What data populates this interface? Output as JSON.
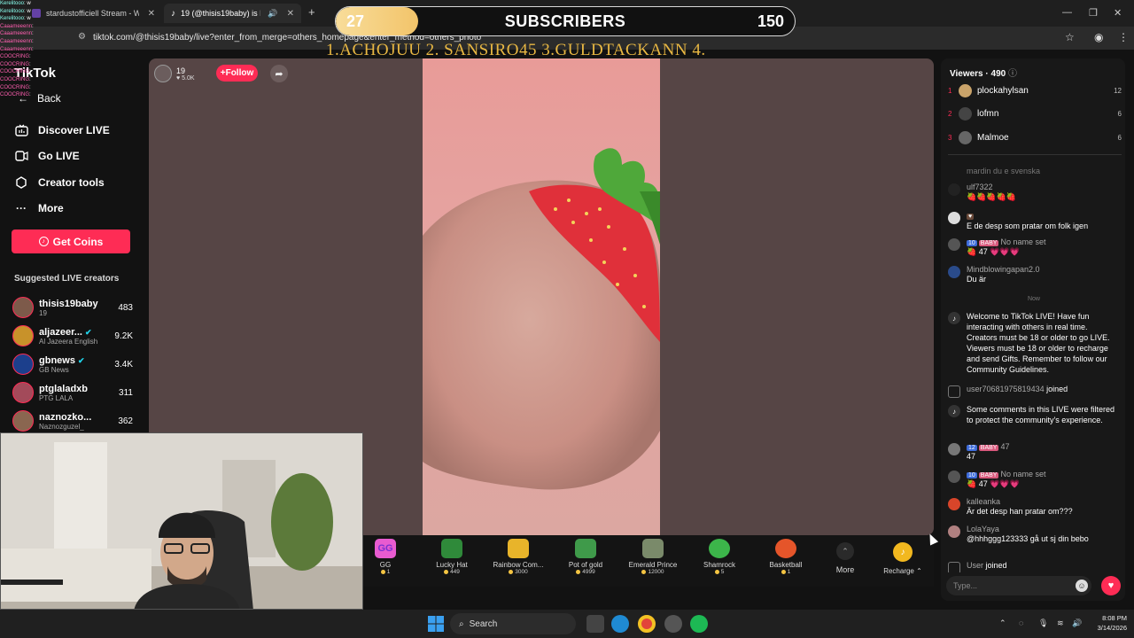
{
  "browser": {
    "tabs": [
      {
        "title": "stardustofficiell Stream - Watch",
        "active": false
      },
      {
        "title": "19 (@thisis19baby) is LIVE",
        "active": true
      }
    ],
    "url": "tiktok.com/@thisis19baby/live?enter_from_merge=others_homepage&enter_method=others_photo"
  },
  "overlay": {
    "subscribers_current": "27",
    "subscribers_label": "SUBSCRIBERS",
    "subscribers_goal": "150",
    "subscribers_progress": 0.18,
    "ranking": "1.ACHOJUU  2. SANSIRO45  3.GULDTACKANN  4."
  },
  "chat_overlay": [
    {
      "user": "Kerelitooo",
      "msg": ": w"
    },
    {
      "user": "Kerelitooo",
      "msg": ": w"
    },
    {
      "user": "Kerelitooo",
      "msg": ": w"
    },
    {
      "user": "Caaameeenn",
      "msg": ":"
    },
    {
      "user": "Caaameeenn",
      "msg": ":"
    },
    {
      "user": "Caaameeenn",
      "msg": ":"
    },
    {
      "user": "Caaameeenn",
      "msg": ":"
    },
    {
      "user": "COOCRING",
      "msg": ":"
    },
    {
      "user": "COOCRING",
      "msg": ":"
    },
    {
      "user": "COOCRING",
      "msg": ":"
    },
    {
      "user": "COOCRING",
      "msg": ":"
    },
    {
      "user": "COOCRING",
      "msg": ":"
    },
    {
      "user": "COOCRING",
      "msg": ":"
    }
  ],
  "sidebar": {
    "logo": "TikTok",
    "back": "Back",
    "nav": [
      {
        "label": "Discover LIVE",
        "icon": "discover-live-icon"
      },
      {
        "label": "Go LIVE",
        "icon": "go-live-icon"
      },
      {
        "label": "Creator tools",
        "icon": "creator-tools-icon"
      },
      {
        "label": "More",
        "icon": "more-icon"
      }
    ],
    "get_coins": "Get Coins",
    "suggested_title": "Suggested LIVE creators",
    "creators": [
      {
        "name": "thisis19baby",
        "sub": "19",
        "count": "483",
        "color": "#7d5a4a"
      },
      {
        "name": "aljazeer...",
        "sub": "Al Jazeera English",
        "count": "9.2K",
        "color": "#c8922a",
        "verified": true
      },
      {
        "name": "gbnews",
        "sub": "GB News",
        "count": "3.4K",
        "color": "#1c3f8c",
        "verified": true
      },
      {
        "name": "ptglaladxb",
        "sub": "PTG LALA",
        "count": "311",
        "color": "#a34a5a"
      },
      {
        "name": "naznozko...",
        "sub": "Naznozguzel_",
        "count": "362",
        "color": "#8a6650"
      }
    ]
  },
  "stream": {
    "host_name": "19",
    "host_likes": "5.0K",
    "follow": "+Follow"
  },
  "gifts": [
    {
      "name": "GG",
      "price": "1",
      "color": "#e85bd0"
    },
    {
      "name": "Lucky Hat",
      "price": "449",
      "color": "#2f8a3a"
    },
    {
      "name": "Rainbow Com...",
      "price": "3000",
      "color": "#e8b42a"
    },
    {
      "name": "Pot of gold",
      "price": "4999",
      "color": "#3f9a4a"
    },
    {
      "name": "Emerald Prince",
      "price": "12000",
      "color": "#7a8a6a"
    },
    {
      "name": "Shamrock",
      "price": "5",
      "color": "#3cb54a"
    },
    {
      "name": "Basketball",
      "price": "1",
      "color": "#e5552a"
    }
  ],
  "gift_more": "More",
  "recharge": "Recharge",
  "viewers": {
    "title": "Viewers · 490",
    "top": [
      {
        "rank": "1",
        "name": "plockahylsan",
        "score": "12",
        "color": "#c9a36a"
      },
      {
        "rank": "2",
        "name": "lofmn",
        "score": "6",
        "color": "#444"
      },
      {
        "rank": "3",
        "name": "Malmoe",
        "score": "6",
        "color": "#666"
      }
    ]
  },
  "chat": {
    "faded": "mardin du e svenska",
    "messages": [
      {
        "user": "ulf7322",
        "text": "🍓🍓🍓🍓🍓",
        "color": "#222"
      },
      {
        "user": "",
        "text": "E de desp som pratar om folk igen",
        "color": "#ddd"
      },
      {
        "user": "No name set",
        "badges": [
          "10",
          "BABY"
        ],
        "text": "🍓 47 💗💗💗",
        "color": "#555"
      },
      {
        "user": "Mindblowingapan2.0",
        "text": "Du är",
        "color": "#2a4b8a"
      }
    ],
    "now_label": "Now",
    "system1": "Welcome to TikTok LIVE! Have fun interacting with others in real time. Creators must be 18 or older to go LIVE. Viewers must be 18 or older to recharge and send Gifts. Remember to follow our Community Guidelines.",
    "joined1_user": "user70681975819434",
    "joined_label": "joined",
    "system2": "Some comments in this LIVE were filtered to protect the community's experience.",
    "messages2": [
      {
        "user": "47",
        "badges": [
          "12",
          "BABY"
        ],
        "text": "47",
        "color": "#777"
      },
      {
        "user": "No name set",
        "badges": [
          "10",
          "BABY"
        ],
        "text": "🍓 47 💗💗💗",
        "color": "#555"
      },
      {
        "user": "kalleanka",
        "text": "Är det desp han pratar om???",
        "color": "#d8452a"
      },
      {
        "user": "LolaYaya",
        "text": "@hhhggg123333 gå ut sj din bebo",
        "color": "#b08080"
      }
    ],
    "joined2_user": "User",
    "placeholder": "Type..."
  },
  "taskbar": {
    "search": "Search",
    "time": "8:08 PM",
    "date": "3/14/2026"
  }
}
